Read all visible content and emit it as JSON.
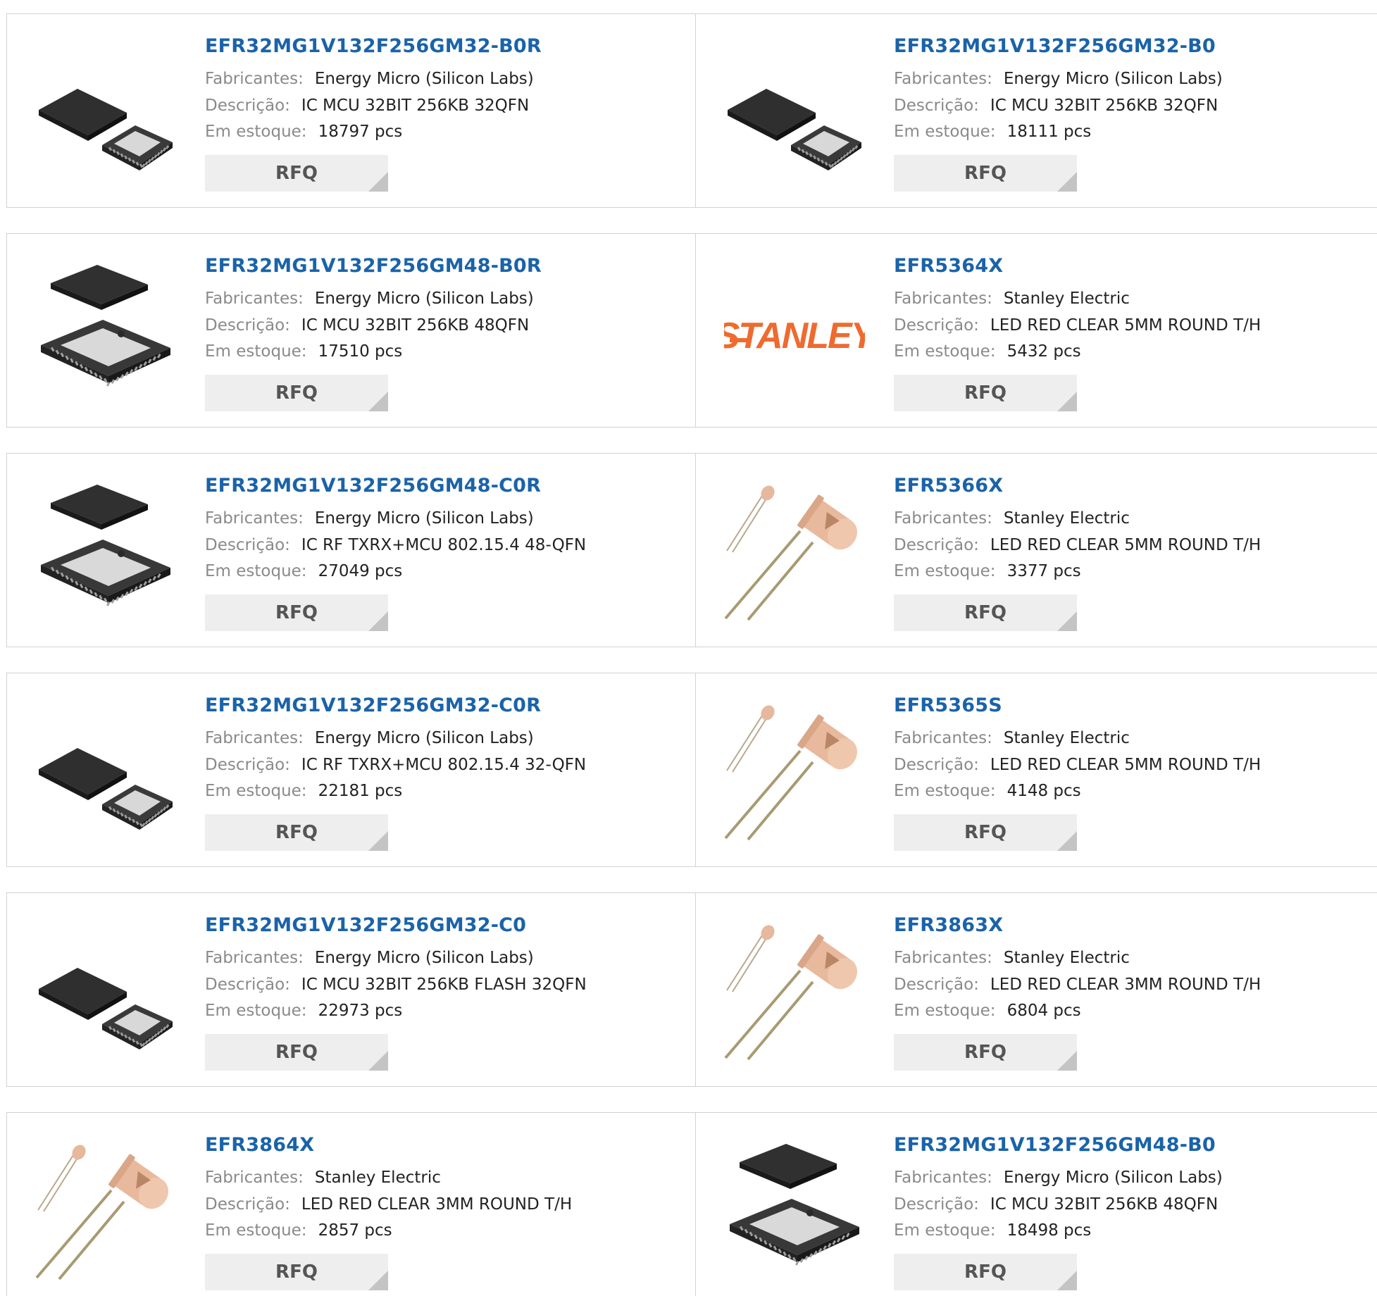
{
  "labels": {
    "manufacturer": "Fabricantes:",
    "description": "Descrição:",
    "stock": "Em estoque:",
    "rfq": "RFQ"
  },
  "products": [
    {
      "part": "EFR32MG1V132F256GM32-B0R",
      "manufacturer": "Energy Micro (Silicon Labs)",
      "description": "IC MCU 32BIT 256KB 32QFN",
      "stock": "18797 pcs",
      "image": "qfn32-chip-icon"
    },
    {
      "part": "EFR32MG1V132F256GM32-B0",
      "manufacturer": "Energy Micro (Silicon Labs)",
      "description": "IC MCU 32BIT 256KB 32QFN",
      "stock": "18111 pcs",
      "image": "qfn32-chip-icon"
    },
    {
      "part": "EFR32MG1V132F256GM48-B0R",
      "manufacturer": "Energy Micro (Silicon Labs)",
      "description": "IC MCU 32BIT 256KB 48QFN",
      "stock": "17510 pcs",
      "image": "qfn48-chip-icon"
    },
    {
      "part": "EFR5364X",
      "manufacturer": "Stanley Electric",
      "description": "LED RED CLEAR 5MM ROUND T/H",
      "stock": "5432 pcs",
      "image": "stanley-logo",
      "logo_text": "STANLEY"
    },
    {
      "part": "EFR32MG1V132F256GM48-C0R",
      "manufacturer": "Energy Micro (Silicon Labs)",
      "description": "IC RF TXRX+MCU 802.15.4 48-QFN",
      "stock": "27049 pcs",
      "image": "qfn48-chip-icon"
    },
    {
      "part": "EFR5366X",
      "manufacturer": "Stanley Electric",
      "description": "LED RED CLEAR 5MM ROUND T/H",
      "stock": "3377 pcs",
      "image": "led-icon"
    },
    {
      "part": "EFR32MG1V132F256GM32-C0R",
      "manufacturer": "Energy Micro (Silicon Labs)",
      "description": "IC RF TXRX+MCU 802.15.4 32-QFN",
      "stock": "22181 pcs",
      "image": "qfn32-chip-icon"
    },
    {
      "part": "EFR5365S",
      "manufacturer": "Stanley Electric",
      "description": "LED RED CLEAR 5MM ROUND T/H",
      "stock": "4148 pcs",
      "image": "led-icon"
    },
    {
      "part": "EFR32MG1V132F256GM32-C0",
      "manufacturer": "Energy Micro (Silicon Labs)",
      "description": "IC MCU 32BIT 256KB FLASH 32QFN",
      "stock": "22973 pcs",
      "image": "qfn32-chip-icon"
    },
    {
      "part": "EFR3863X",
      "manufacturer": "Stanley Electric",
      "description": "LED RED CLEAR 3MM ROUND T/H",
      "stock": "6804 pcs",
      "image": "led-icon"
    },
    {
      "part": "EFR3864X",
      "manufacturer": "Stanley Electric",
      "description": "LED RED CLEAR 3MM ROUND T/H",
      "stock": "2857 pcs",
      "image": "led-icon"
    },
    {
      "part": "EFR32MG1V132F256GM48-B0",
      "manufacturer": "Energy Micro (Silicon Labs)",
      "description": "IC MCU 32BIT 256KB 48QFN",
      "stock": "18498 pcs",
      "image": "qfn48-chip-icon"
    }
  ]
}
